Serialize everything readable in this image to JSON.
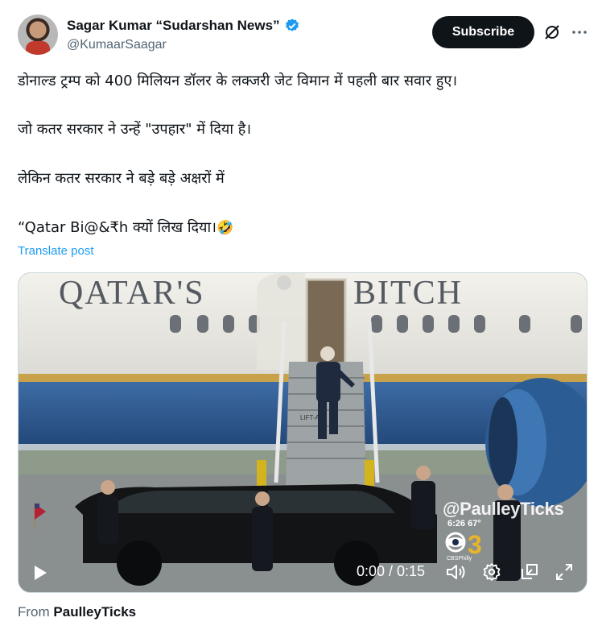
{
  "author": {
    "name": "Sagar Kumar “Sudarshan News”",
    "handle": "@KumaarSaagar",
    "verified_icon": "verified-badge-icon",
    "badge_color": "#1d9bf0"
  },
  "actions": {
    "subscribe_label": "Subscribe",
    "grok_icon": "grok-icon",
    "more_icon": "more-icon"
  },
  "tweet": {
    "lines": [
      "डोनाल्ड ट्रम्प को 400 मिलियन डॉलर के लक्जरी जेट विमान में पहली बार सवार हुए।",
      "जो कतर सरकार ने उन्हें \"उपहार\" में दिया है।",
      "लेकिन कतर सरकार ने बड़े बड़े अक्षरों में",
      "“Qatar Bi@&₹h क्यों लिख दिया।"
    ],
    "emoji": "🤣",
    "translate_label": "Translate post"
  },
  "video": {
    "plane_text_left": "QATAR'S",
    "plane_text_right": "BITCH",
    "stair_label": "LIFT-A",
    "watermark": "@PaulleyTicks",
    "station_info": "6:26  67°",
    "station_logo": "3",
    "station_sub": "CBSPhilly",
    "time": "0:00 / 0:15",
    "progress": 0
  },
  "source": {
    "prefix": "From",
    "name": "PaulleyTicks"
  },
  "colors": {
    "text": "#0f1419",
    "secondary": "#536471",
    "link": "#1d9bf0",
    "plane_blue": "#2f5a8f"
  }
}
